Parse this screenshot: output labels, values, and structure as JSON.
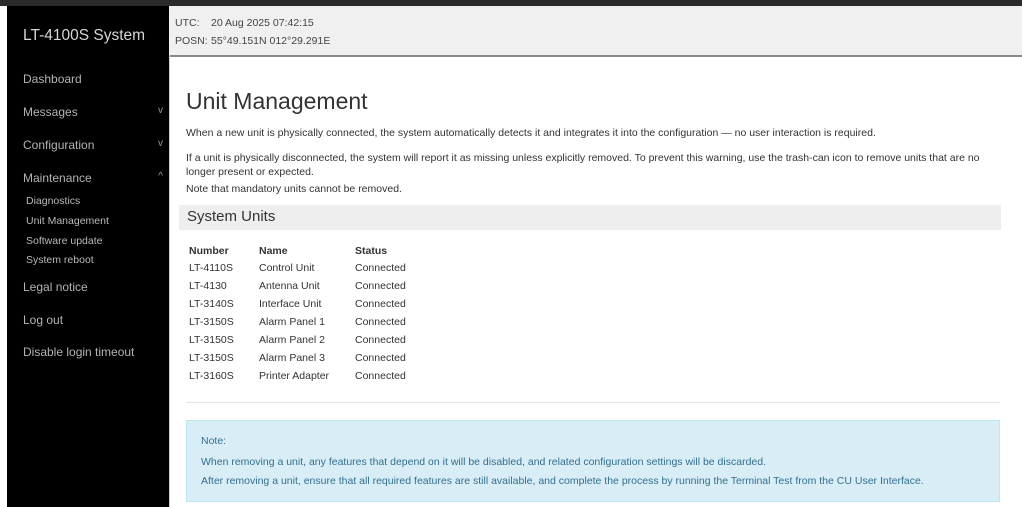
{
  "sidebar": {
    "brand": "LT-4100S System",
    "items": [
      {
        "label": "Dashboard"
      },
      {
        "label": "Messages",
        "chevron": "v"
      },
      {
        "label": "Configuration",
        "chevron": "v"
      },
      {
        "label": "Maintenance",
        "chevron": "^"
      }
    ],
    "sub_items": [
      "Diagnostics",
      "Unit Management",
      "Software update",
      "System reboot"
    ],
    "bottom_items": [
      "Legal notice",
      "Log out",
      "Disable login timeout"
    ]
  },
  "status": {
    "utc_label": "UTC:",
    "utc_value": "20 Aug 2025 07:42:15",
    "posn_label": "POSN:",
    "posn_value": "55°49.151N 012°29.291E"
  },
  "main": {
    "title": "Unit Management",
    "para1": "When a new unit is physically connected, the system automatically detects it and integrates it into the configuration — no user interaction is required.",
    "para2": "If a unit is physically disconnected, the system will report it as missing unless explicitly removed. To prevent this warning, use the trash-can icon to remove units that are no longer present or expected.",
    "para3": "Note that mandatory units cannot be removed.",
    "section_title": "System Units",
    "table": {
      "headers": [
        "Number",
        "Name",
        "Status"
      ],
      "rows": [
        [
          "LT-4110S",
          "Control Unit",
          "Connected"
        ],
        [
          "LT-4130",
          "Antenna Unit",
          "Connected"
        ],
        [
          "LT-3140S",
          "Interface Unit",
          "Connected"
        ],
        [
          "LT-3150S",
          "Alarm Panel 1",
          "Connected"
        ],
        [
          "LT-3150S",
          "Alarm Panel 2",
          "Connected"
        ],
        [
          "LT-3150S",
          "Alarm Panel 3",
          "Connected"
        ],
        [
          "LT-3160S",
          "Printer Adapter",
          "Connected"
        ]
      ]
    },
    "note": {
      "title": "Note:",
      "line1": "When removing a unit, any features that depend on it will be disabled, and related configuration settings will be discarded.",
      "line2": "After removing a unit, ensure that all required features are still available, and complete the process by running the Terminal Test from the CU User Interface."
    }
  }
}
